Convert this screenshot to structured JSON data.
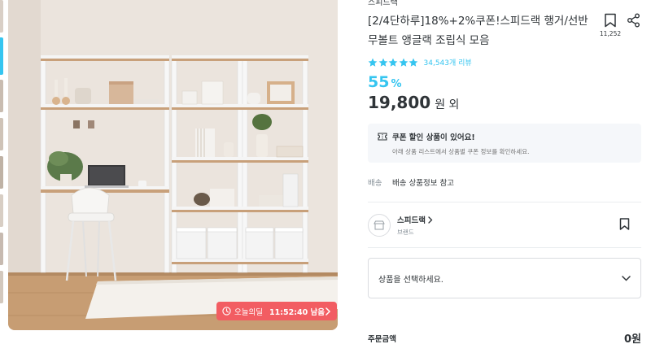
{
  "colors": {
    "accent": "#35c5f0",
    "deal": "#f25d62",
    "text": "#2f3438",
    "muted": "#828c94"
  },
  "product": {
    "brand": "스피드랙",
    "title": "[2/4단하루]18%+2%쿠폰!스피드랙 행거/선반 무볼트 앵글랙 조립식 모음",
    "bookmark_count": "11,252",
    "rating": 5,
    "review_text": "34,543개 리뷰",
    "discount_value": "55",
    "discount_unit": "%",
    "price": "19,800",
    "price_suffix": "원 외"
  },
  "deal": {
    "label": "오늘의딜",
    "timer": "11:52:40 남음"
  },
  "coupon": {
    "title": "쿠폰 할인 상품이 있어요!",
    "subtitle": "아래 상품 리스트에서 상품별 쿠폰 정보를 확인하세요."
  },
  "shipping": {
    "label": "배송",
    "value": "배송 상품정보 참고"
  },
  "brand_card": {
    "name": "스피드랙",
    "subtitle": "브랜드"
  },
  "option_select": {
    "placeholder": "상품을 선택하세요."
  },
  "order": {
    "label": "주문금액",
    "value": "0원"
  },
  "icons": {
    "bookmark": "bookmark-icon",
    "share": "share-icon",
    "star": "star-icon",
    "coupon": "coupon-icon",
    "clock": "clock-icon",
    "chevron_right": "chevron-right-icon",
    "chevron_down": "chevron-down-icon"
  }
}
